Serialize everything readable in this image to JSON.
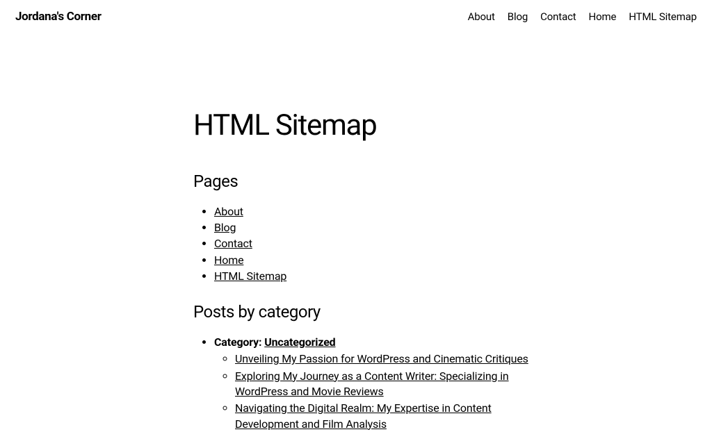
{
  "siteTitle": "Jordana's Corner",
  "nav": {
    "items": [
      {
        "label": "About"
      },
      {
        "label": "Blog"
      },
      {
        "label": "Contact"
      },
      {
        "label": "Home"
      },
      {
        "label": "HTML Sitemap"
      }
    ]
  },
  "pageTitle": "HTML Sitemap",
  "pagesHeading": "Pages",
  "pages": [
    {
      "label": "About"
    },
    {
      "label": "Blog"
    },
    {
      "label": "Contact"
    },
    {
      "label": "Home"
    },
    {
      "label": "HTML Sitemap"
    }
  ],
  "postsHeading": "Posts by category",
  "categoryPrefix": "Category: ",
  "categoryName": "Uncategorized",
  "posts": [
    {
      "title": "Unveiling My Passion for WordPress and Cinematic Critiques"
    },
    {
      "title": "Exploring My Journey as a Content Writer: Specializing in WordPress and Movie Reviews"
    },
    {
      "title": "Navigating the Digital Realm: My Expertise in Content Development and Film Analysis"
    }
  ]
}
